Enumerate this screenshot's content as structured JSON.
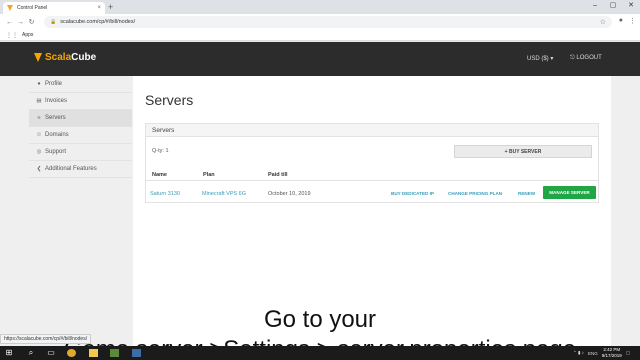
{
  "browser": {
    "tab_title": "Control Panel",
    "tab_close": "×",
    "new_tab": "+",
    "window_controls": [
      "–",
      "▢",
      "✕"
    ],
    "url": "scalacube.com/cp/#/bill/nodes/",
    "bookmarks_label": "Apps",
    "status_url": "https://scalacube.com/cp/#/bill/nodes/"
  },
  "header": {
    "logo_part1": "Scala",
    "logo_part2": "Cube",
    "currency": "USD ($) ▾",
    "logout": "LOGOUT"
  },
  "sidebar": {
    "items": [
      {
        "label": "Profile",
        "icon": "user-icon"
      },
      {
        "label": "Invoices",
        "icon": "invoice-icon"
      },
      {
        "label": "Servers",
        "icon": "servers-icon"
      },
      {
        "label": "Domains",
        "icon": "globe-icon"
      },
      {
        "label": "Support",
        "icon": "support-icon"
      },
      {
        "label": "Additional Features",
        "icon": "share-icon"
      }
    ],
    "active": "Servers"
  },
  "main": {
    "title": "Servers",
    "panel_title": "Servers",
    "qty": "Q-ty: 1",
    "buy_server": "+ BUY SERVER",
    "columns": [
      "Name",
      "Plan",
      "Paid till"
    ],
    "rows": [
      {
        "name": "Saturn 3130",
        "plan": "Minecraft VPS 6G",
        "paid_till": "October 10, 2019",
        "actions": [
          "BUY DEDICATED IP",
          "CHANGE PRICING PLAN",
          "RENEW"
        ],
        "manage": "MANAGE SERVER"
      }
    ]
  },
  "caption": {
    "line1": "Go to your",
    "line2": "Game server >Settings > server.properties page"
  },
  "taskbar": {
    "language": "ENG",
    "time": "2:42 PM",
    "date": "9/17/2019"
  },
  "colors": {
    "accent": "#f7a600",
    "link": "#3a9bb9",
    "manage_button": "#21a646",
    "header_bg": "#2c2c2c"
  }
}
